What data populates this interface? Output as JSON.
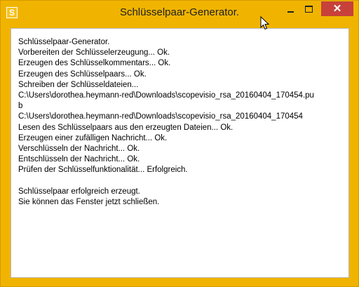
{
  "window": {
    "title": "Schlüsselpaar-Generator.",
    "app_icon_glyph": "S",
    "controls": {
      "minimize_icon": "minimize-icon",
      "maximize_icon": "maximize-icon",
      "close_glyph": "✕"
    },
    "accent_color": "#f0b400",
    "close_color": "#c7413a"
  },
  "log": {
    "lines": [
      "Schlüsselpaar-Generator.",
      "Vorbereiten der Schlüsselerzeugung... Ok.",
      "Erzeugen des Schlüsselkommentars... Ok.",
      "Erzeugen des Schlüsselpaars... Ok.",
      "Schreiben der Schlüsseldateien...",
      "C:\\Users\\dorothea.heymann-red\\Downloads\\scopevisio_rsa_20160404_170454.pu",
      "b",
      "C:\\Users\\dorothea.heymann-red\\Downloads\\scopevisio_rsa_20160404_170454",
      "Lesen des Schlüsselpaars aus den erzeugten Dateien... Ok.",
      "Erzeugen einer zufälligen Nachricht... Ok.",
      "Verschlüsseln der Nachricht... Ok.",
      "Entschlüsseln der Nachricht... Ok.",
      "Prüfen der Schlüsselfunktionalität... Erfolgreich.",
      "",
      "Schlüsselpaar erfolgreich erzeugt.",
      "Sie können das Fenster jetzt schließen."
    ]
  }
}
